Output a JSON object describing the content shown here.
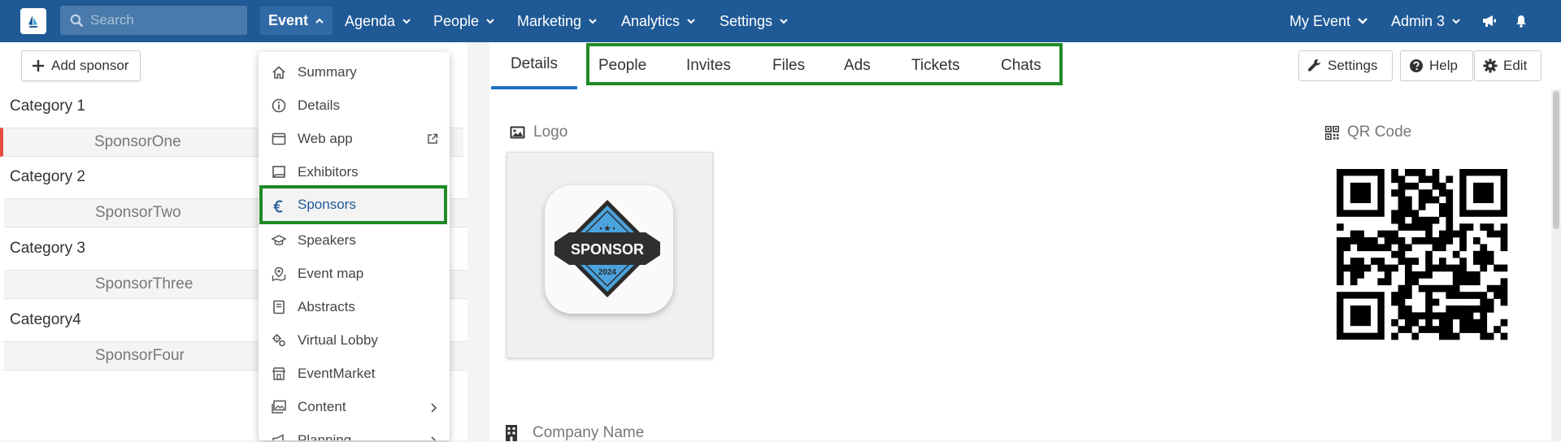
{
  "topbar": {
    "search_placeholder": "Search",
    "nav": [
      {
        "label": "Event"
      },
      {
        "label": "Agenda"
      },
      {
        "label": "People"
      },
      {
        "label": "Marketing"
      },
      {
        "label": "Analytics"
      },
      {
        "label": "Settings"
      }
    ],
    "my_event": "My Event",
    "user": "Admin 3"
  },
  "left": {
    "add_label": "Add sponsor",
    "categories": [
      {
        "name": "Category 1",
        "sponsor": "SponsorOne"
      },
      {
        "name": "Category 2",
        "sponsor": "SponsorTwo"
      },
      {
        "name": "Category 3",
        "sponsor": "SponsorThree"
      },
      {
        "name": "Category4",
        "sponsor": "SponsorFour"
      }
    ]
  },
  "event_menu": {
    "items": [
      {
        "label": "Summary",
        "icon": "home-icon"
      },
      {
        "label": "Details",
        "icon": "info-icon"
      },
      {
        "label": "Web app",
        "icon": "browser-icon"
      },
      {
        "label": "Exhibitors",
        "icon": "exhibitor-icon"
      },
      {
        "label": "Sponsors",
        "icon": "euro-icon"
      },
      {
        "label": "Speakers",
        "icon": "graduation-cap-icon"
      },
      {
        "label": "Event map",
        "icon": "map-icon"
      },
      {
        "label": "Abstracts",
        "icon": "book-icon"
      },
      {
        "label": "Virtual Lobby",
        "icon": "gears-icon"
      },
      {
        "label": "EventMarket",
        "icon": "store-icon"
      },
      {
        "label": "Content",
        "icon": "images-icon"
      },
      {
        "label": "Planning",
        "icon": "megaphone-icon"
      }
    ],
    "active": "Sponsors"
  },
  "tabs": [
    "Details",
    "People",
    "Invites",
    "Files",
    "Ads",
    "Tickets",
    "Chats"
  ],
  "active_tab": "Details",
  "actions": {
    "settings": "Settings",
    "help": "Help",
    "edit": "Edit"
  },
  "detail": {
    "logo_label": "Logo",
    "qr_label": "QR Code",
    "company_label": "Company Name",
    "badge_text": "SPONSOR",
    "badge_year": "2024"
  },
  "colors": {
    "topbar": "#1f5a96",
    "highlight": "#1f8a26",
    "badge_blue": "#4ba3dd",
    "badge_dark": "#2f2f2f"
  }
}
